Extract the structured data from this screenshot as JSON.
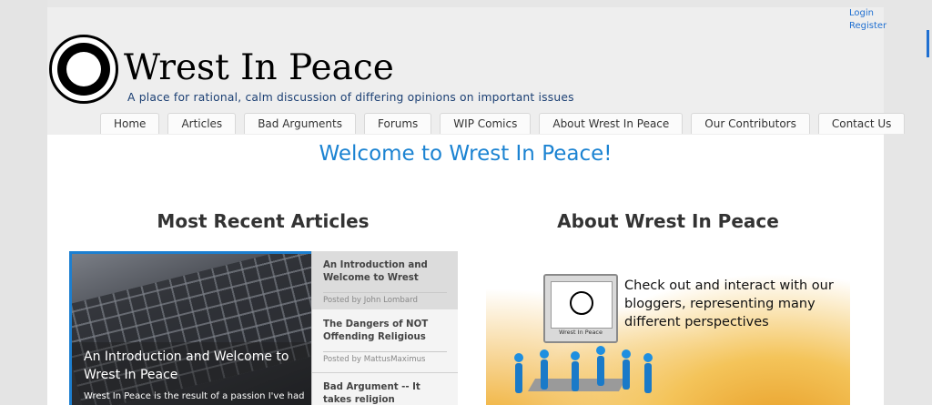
{
  "header": {
    "login": "Login",
    "register": "Register",
    "site_title": "Wrest In Peace",
    "tagline": "A place for rational, calm discussion of differing opinions on important issues"
  },
  "nav": {
    "home": "Home",
    "articles": "Articles",
    "bad_arguments": "Bad Arguments",
    "forums": "Forums",
    "wip_comics": "WIP Comics",
    "about": "About Wrest In Peace",
    "contributors": "Our Contributors",
    "contact": "Contact Us"
  },
  "main": {
    "welcome": "Welcome to Wrest In Peace!",
    "recent_heading": "Most Recent Articles",
    "about_heading": "About Wrest In Peace"
  },
  "featured": {
    "title": "An Introduction and Welcome to Wrest In Peace",
    "excerpt": "Wrest In Peace is the result of a passion I've had"
  },
  "articles": [
    {
      "title": "An Introduction and Welcome to Wrest",
      "meta": "Posted by John Lombard"
    },
    {
      "title": "The Dangers of NOT Offending Religious",
      "meta": "Posted by MattusMaximus"
    },
    {
      "title": "Bad Argument -- It takes religion",
      "meta": ""
    }
  ],
  "about_panel": {
    "text": "Check out and interact with our bloggers, representing many different perspectives",
    "monitor_label": "Wrest In Peace"
  },
  "colors": {
    "link": "#1f6fd1",
    "welcome": "#1b83d2",
    "tagline": "#1b3f73"
  }
}
